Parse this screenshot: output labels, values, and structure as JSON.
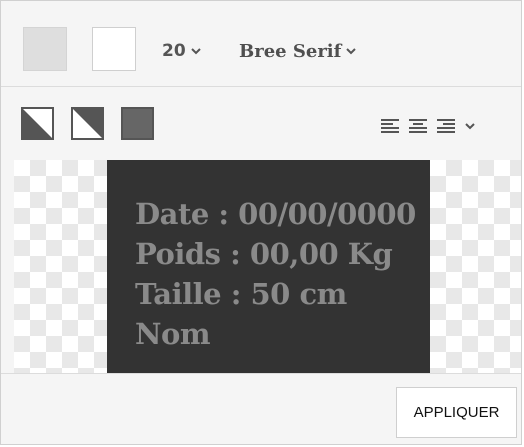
{
  "toolbar": {
    "font_size": "20",
    "font_family": "Bree Serif"
  },
  "preview": {
    "lines": [
      "Date : 00/00/0000",
      "Poids : 00,00 Kg",
      "Taille : 50 cm",
      "Nom"
    ]
  },
  "footer": {
    "apply_label": "APPLIQUER"
  },
  "colors": {
    "label_background": "#333333",
    "label_text": "#8a8a8a",
    "swatch_background": "#dedede",
    "swatch_foreground": "#ffffff"
  },
  "icons": {
    "style_buttons": [
      "half-diagonal-light-icon",
      "half-diagonal-dark-icon",
      "filled-square-icon"
    ],
    "alignment": [
      "align-left-icon",
      "align-center-icon",
      "align-right-icon",
      "chevron-down-icon"
    ]
  }
}
